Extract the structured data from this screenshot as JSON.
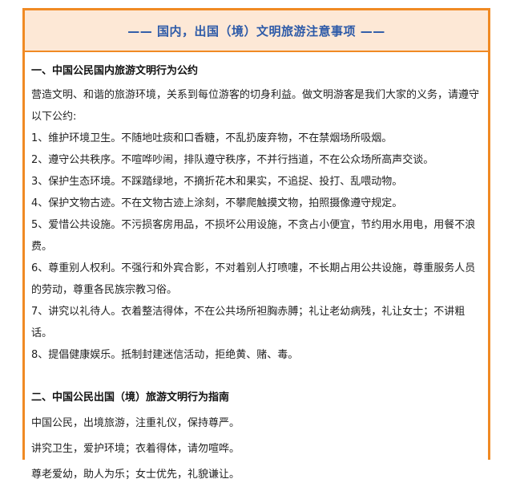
{
  "banner": {
    "title": "—— 国内，出国（境）文明旅游注意事项 ——"
  },
  "section1": {
    "heading": "一、中国公民国内旅游文明行为公约",
    "intro": "营造文明、和谐的旅游环境，关系到每位游客的切身利益。做文明游客是我们大家的义务，请遵守以下公约:",
    "rules": [
      "1、维护环境卫生。不随地吐痰和口香糖，不乱扔废弃物，不在禁烟场所吸烟。",
      "2、遵守公共秩序。不喧哗吵闹，排队遵守秩序，不并行挡道，不在公众场所高声交谈。",
      "3、保护生态环境。不踩踏绿地，不摘折花木和果实，不追捉、投打、乱喂动物。",
      "4、保护文物古迹。不在文物古迹上涂刻，不攀爬触摸文物，拍照摄像遵守规定。",
      "5、爱惜公共设施。不污损客房用品，不损坏公用设施，不贪占小便宜，节约用水用电，用餐不浪费。",
      "6、尊重别人权利。不强行和外宾合影，不对着别人打喷嚏，不长期占用公共设施，尊重服务人员的劳动，尊重各民族宗教习俗。",
      "7、讲究以礼待人。衣着整洁得体，不在公共场所袒胸赤膊；礼让老幼病残，礼让女士；不讲粗话。",
      "8、提倡健康娱乐。抵制封建迷信活动，拒绝黄、赌、毒。"
    ]
  },
  "section2": {
    "heading": "二、中国公民出国（境）旅游文明行为指南",
    "lines": [
      "中国公民，出境旅游，注重礼仪，保持尊严。",
      "讲究卫生，爱护环境；衣着得体，请勿喧哗。",
      "尊老爱幼，助人为乐；女士优先，礼貌谦让。"
    ]
  }
}
